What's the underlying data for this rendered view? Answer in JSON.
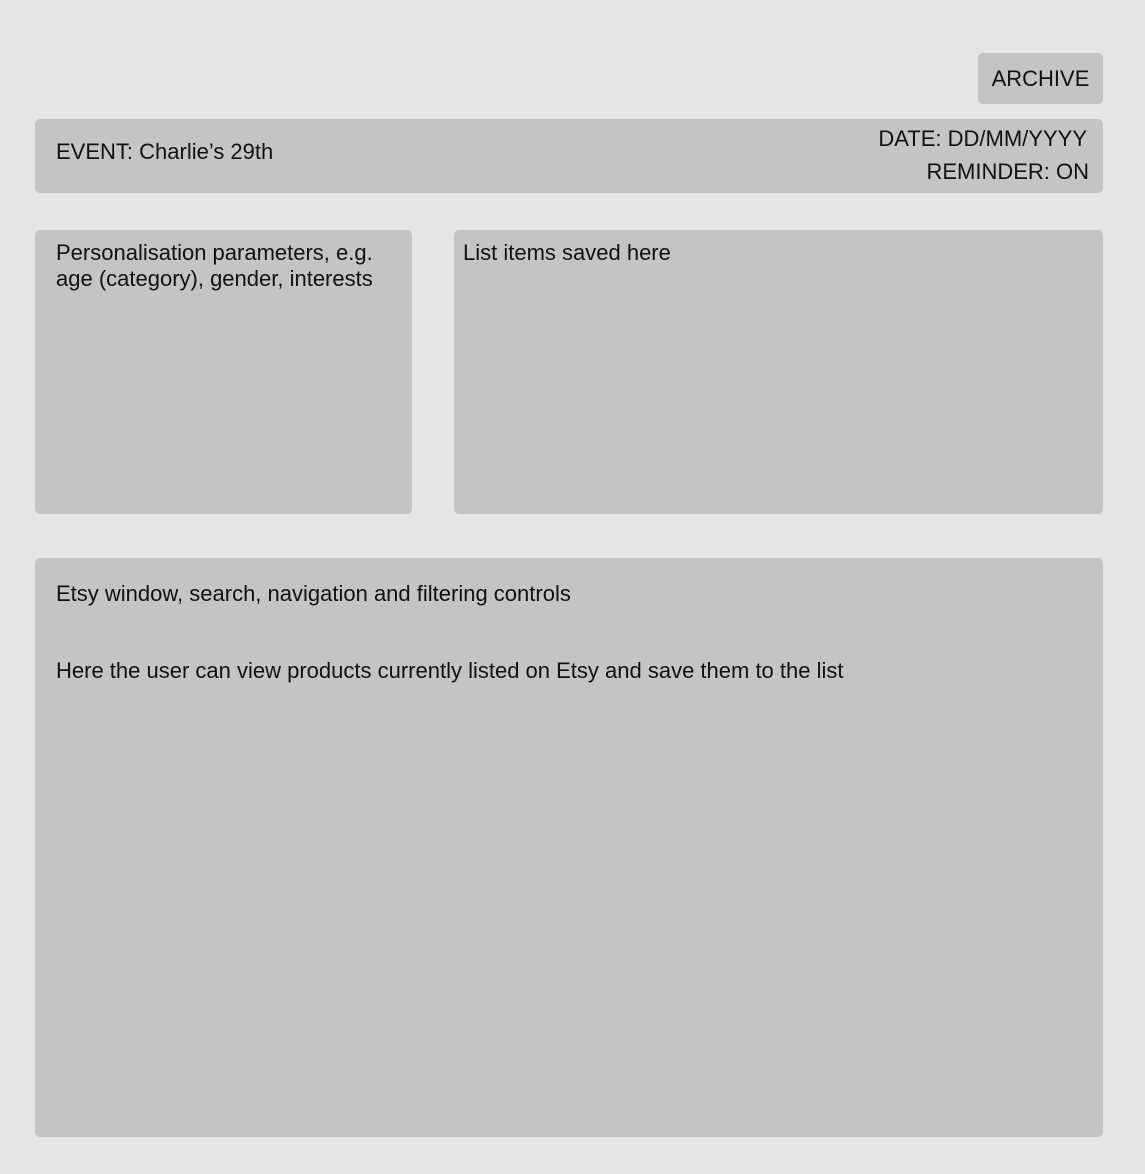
{
  "header": {
    "archive_label": "ARCHIVE"
  },
  "event_bar": {
    "event": "EVENT: Charlie’s 29th",
    "date": "DATE: DD/MM/YYYY",
    "reminder": "REMINDER: ON"
  },
  "personalisation": {
    "text": "Personalisation parameters, e.g. age (category), gender, interests"
  },
  "saved_list": {
    "text": "List items saved here"
  },
  "etsy_window": {
    "title": "Etsy window, search, navigation and filtering controls",
    "description": "Here the user can view products currently listed on Etsy and save them to the list"
  },
  "colors": {
    "background": "#e5e5e5",
    "panel": "#c4c4c4",
    "text": "#111111"
  }
}
